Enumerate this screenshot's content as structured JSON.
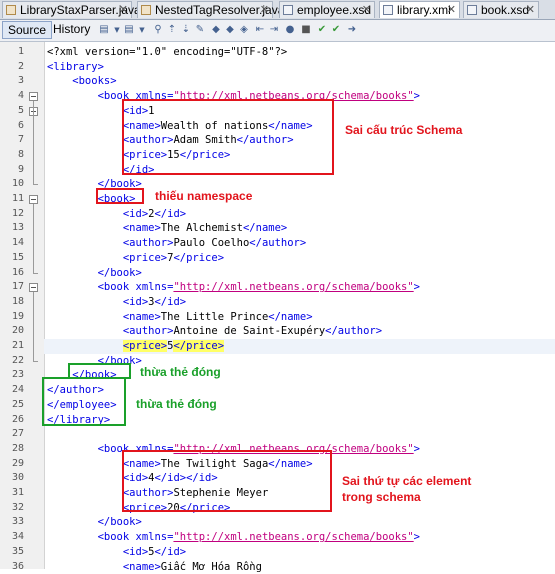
{
  "tabs": [
    {
      "label": "LibraryStaxParser.java",
      "type": "java"
    },
    {
      "label": "NestedTagResolver.java",
      "type": "java"
    },
    {
      "label": "employee.xsd",
      "type": "xsd"
    },
    {
      "label": "library.xml",
      "type": "xml",
      "active": true
    },
    {
      "label": "book.xsd",
      "type": "xsd"
    }
  ],
  "toolbar": {
    "source_label": "Source",
    "history_label": "History"
  },
  "code": [
    {
      "n": "1",
      "parts": [
        [
          "decl",
          "<?xml version=\"1.0\" encoding=\"UTF-8\"?>"
        ]
      ]
    },
    {
      "n": "2",
      "parts": [
        [
          "tag",
          "<library>"
        ]
      ]
    },
    {
      "n": "3",
      "parts": [
        [
          "tag",
          "    <books>"
        ]
      ]
    },
    {
      "n": "4",
      "parts": [
        [
          "tag",
          "        <book "
        ],
        [
          "attr",
          "xmlns="
        ],
        [
          "aval",
          "\"http://xml.netbeans.org/schema/books\""
        ],
        [
          "tag",
          ">"
        ]
      ]
    },
    {
      "n": "5",
      "parts": [
        [
          "tag",
          "            <id>"
        ],
        [
          "txt",
          "1"
        ]
      ]
    },
    {
      "n": "6",
      "parts": [
        [
          "tag",
          "            <name>"
        ],
        [
          "txt",
          "Wealth of nations"
        ],
        [
          "tag",
          "</name>"
        ]
      ]
    },
    {
      "n": "7",
      "parts": [
        [
          "tag",
          "            <author>"
        ],
        [
          "txt",
          "Adam Smith"
        ],
        [
          "tag",
          "</author>"
        ]
      ]
    },
    {
      "n": "8",
      "parts": [
        [
          "tag",
          "            <price>"
        ],
        [
          "txt",
          "15"
        ],
        [
          "tag",
          "</price>"
        ]
      ]
    },
    {
      "n": "9",
      "parts": [
        [
          "tag",
          "            </id>"
        ]
      ]
    },
    {
      "n": "10",
      "parts": [
        [
          "tag",
          "        </book>"
        ]
      ]
    },
    {
      "n": "11",
      "parts": [
        [
          "tag",
          "        <book>"
        ]
      ]
    },
    {
      "n": "12",
      "parts": [
        [
          "tag",
          "            <id>"
        ],
        [
          "txt",
          "2"
        ],
        [
          "tag",
          "</id>"
        ]
      ]
    },
    {
      "n": "13",
      "parts": [
        [
          "tag",
          "            <name>"
        ],
        [
          "txt",
          "The Alchemist"
        ],
        [
          "tag",
          "</name>"
        ]
      ]
    },
    {
      "n": "14",
      "parts": [
        [
          "tag",
          "            <author>"
        ],
        [
          "txt",
          "Paulo Coelho"
        ],
        [
          "tag",
          "</author>"
        ]
      ]
    },
    {
      "n": "15",
      "parts": [
        [
          "tag",
          "            <price>"
        ],
        [
          "txt",
          "7"
        ],
        [
          "tag",
          "</price>"
        ]
      ]
    },
    {
      "n": "16",
      "parts": [
        [
          "tag",
          "        </book>"
        ]
      ]
    },
    {
      "n": "17",
      "parts": [
        [
          "tag",
          "        <book "
        ],
        [
          "attr",
          "xmlns="
        ],
        [
          "aval",
          "\"http://xml.netbeans.org/schema/books\""
        ],
        [
          "tag",
          ">"
        ]
      ]
    },
    {
      "n": "18",
      "parts": [
        [
          "tag",
          "            <id>"
        ],
        [
          "txt",
          "3"
        ],
        [
          "tag",
          "</id>"
        ]
      ]
    },
    {
      "n": "19",
      "parts": [
        [
          "tag",
          "            <name>"
        ],
        [
          "txt",
          "The Little Prince"
        ],
        [
          "tag",
          "</name>"
        ]
      ]
    },
    {
      "n": "20",
      "parts": [
        [
          "tag",
          "            <author>"
        ],
        [
          "txt",
          "Antoine de Saint-Exupéry"
        ],
        [
          "tag",
          "</author>"
        ]
      ]
    },
    {
      "n": "21",
      "parts": [
        [
          "tag",
          "            "
        ],
        [
          "hl",
          "<price>"
        ],
        [
          "txt",
          "5"
        ],
        [
          "hl",
          "</price>"
        ]
      ],
      "current": true
    },
    {
      "n": "22",
      "parts": [
        [
          "tag",
          "        </book>"
        ]
      ]
    },
    {
      "n": "23",
      "parts": [
        [
          "tag",
          "    </book>"
        ]
      ]
    },
    {
      "n": "24",
      "parts": [
        [
          "tag",
          "</author>"
        ]
      ]
    },
    {
      "n": "25",
      "parts": [
        [
          "tag",
          "</employee>"
        ]
      ]
    },
    {
      "n": "26",
      "parts": [
        [
          "tag",
          "</library>"
        ]
      ]
    },
    {
      "n": "27",
      "parts": []
    },
    {
      "n": "28",
      "parts": [
        [
          "tag",
          "        <book "
        ],
        [
          "attr",
          "xmlns="
        ],
        [
          "aval",
          "\"http://xml.netbeans.org/schema/books\""
        ],
        [
          "tag",
          ">"
        ]
      ]
    },
    {
      "n": "29",
      "parts": [
        [
          "tag",
          "            <name>"
        ],
        [
          "txt",
          "The Twilight Saga"
        ],
        [
          "tag",
          "</name>"
        ]
      ]
    },
    {
      "n": "30",
      "parts": [
        [
          "tag",
          "            <id>"
        ],
        [
          "txt",
          "4"
        ],
        [
          "tag",
          "</id></id>"
        ]
      ]
    },
    {
      "n": "31",
      "parts": [
        [
          "tag",
          "            <author>"
        ],
        [
          "txt",
          "Stephenie Meyer"
        ]
      ]
    },
    {
      "n": "32",
      "parts": [
        [
          "tag",
          "            <price>"
        ],
        [
          "txt",
          "20"
        ],
        [
          "tag",
          "</price>"
        ]
      ]
    },
    {
      "n": "33",
      "parts": [
        [
          "tag",
          "        </book>"
        ]
      ]
    },
    {
      "n": "34",
      "parts": [
        [
          "tag",
          "        <book "
        ],
        [
          "attr",
          "xmlns="
        ],
        [
          "aval",
          "\"http://xml.netbeans.org/schema/books\""
        ],
        [
          "tag",
          ">"
        ]
      ]
    },
    {
      "n": "35",
      "parts": [
        [
          "tag",
          "            <id>"
        ],
        [
          "txt",
          "5"
        ],
        [
          "tag",
          "</id>"
        ]
      ]
    },
    {
      "n": "36",
      "parts": [
        [
          "tag",
          "            <name>"
        ],
        [
          "txt",
          "Giấc Mơ Hóa Rồng"
        ]
      ]
    }
  ],
  "annotations": {
    "schema_error": "Sai cấu trúc Schema",
    "missing_namespace": "thiếu namespace",
    "extra_close_1": "thừa thẻ đóng",
    "extra_close_2": "thừa thẻ đóng",
    "order_error_1": "Sai thứ tự các element",
    "order_error_2": "trong schema"
  },
  "colors": {
    "error": "#e2141c",
    "warning_ok": "#1aa02a",
    "tag": "#0000e6",
    "attr_value": "#c0007f",
    "highlight": "#ffff66"
  }
}
